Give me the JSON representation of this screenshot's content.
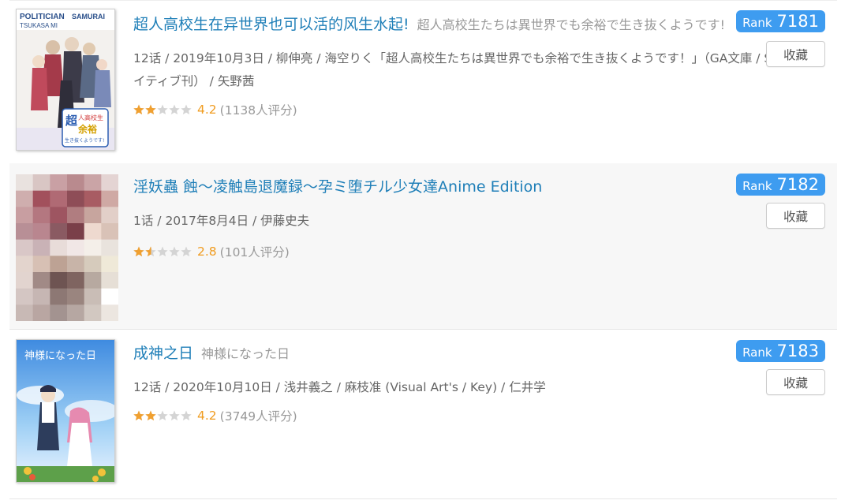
{
  "items": [
    {
      "title": "超人高校生在异世界也可以活的风生水起!",
      "subtitle": "超人高校生たちは異世界でも余裕で生き抜くようです!",
      "meta": "12话 / 2019年10月3日 / 柳伸亮 / 海空りく「超人高校生たちは異世界でも余裕で生き抜くようです！」（GA文庫 / SBクリエイティブ刊） / 矢野茜",
      "score": "4.2",
      "total": "(1138人评分)",
      "stars_fraction": 0.4,
      "rank_label": "Rank",
      "rank": "7181",
      "collect": "收藏",
      "cover_text": {
        "top1": "POLITICIAN",
        "top2": "SAMURAI",
        "top3": "TSUKASA MI",
        "badge1": "超",
        "badge2": "人高校生",
        "badge3": "余裕",
        "badge4": "生き抜くようです!"
      }
    },
    {
      "title": "淫妖蟲 蝕～凌触島退魔録～孕ミ堕チル少女達Anime Edition",
      "subtitle": "",
      "meta": "1话 / 2017年8月4日 / 伊藤史夫",
      "score": "2.8",
      "total": "(101人评分)",
      "stars_fraction": 0.3,
      "rank_label": "Rank",
      "rank": "7182",
      "collect": "收藏"
    },
    {
      "title": "成神之日",
      "subtitle": "神様になった日",
      "meta": "12话 / 2020年10月10日 / 浅井義之 / 麻枝准 (Visual Art's / Key) / 仁井学",
      "score": "4.2",
      "total": "(3749人评分)",
      "stars_fraction": 0.4,
      "rank_label": "Rank",
      "rank": "7183",
      "collect": "收藏",
      "cover_text": {
        "logo": "神様になった日"
      }
    }
  ],
  "colors": {
    "link": "#1f7fb8",
    "rank_bg": "#3e9cf0",
    "score": "#f09c20",
    "star_on": "#f0a030",
    "star_off": "#d4d4d4"
  }
}
